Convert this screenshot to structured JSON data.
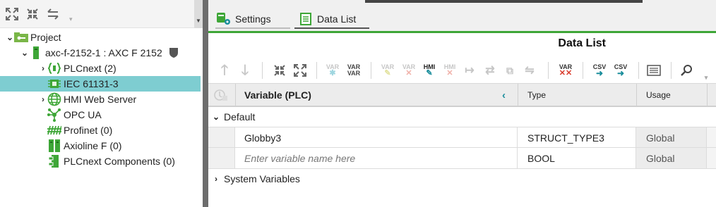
{
  "tree": {
    "items": [
      {
        "label": "Project"
      },
      {
        "label": "axc-f-2152-1 : AXC F 2152"
      },
      {
        "label": "PLCnext (2)"
      },
      {
        "label": "IEC 61131-3"
      },
      {
        "label": "HMI Web Server"
      },
      {
        "label": "OPC UA"
      },
      {
        "label": "Profinet (0)"
      },
      {
        "label": "Axioline F (0)"
      },
      {
        "label": "PLCnext Components (0)"
      }
    ]
  },
  "tabs": [
    {
      "label": "Settings"
    },
    {
      "label": "Data List"
    }
  ],
  "view_title": "Data List",
  "toolbar": {
    "var_label": "VAR",
    "hmi_label": "HMI",
    "csv_label": "CSV"
  },
  "grid": {
    "columns": {
      "variable": "Variable (PLC)",
      "type": "Type",
      "usage": "Usage"
    },
    "groups": {
      "default": "Default",
      "system": "System Variables"
    },
    "rows": [
      {
        "name": "Globby3",
        "type": "STRUCT_TYPE3",
        "usage": "Global"
      },
      {
        "name_placeholder": "Enter variable name here",
        "type": "BOOL",
        "usage": "Global"
      }
    ]
  },
  "colors": {
    "accent_green": "#3ea637",
    "selection": "#7ecdd1",
    "teal": "#1b8e9c"
  }
}
